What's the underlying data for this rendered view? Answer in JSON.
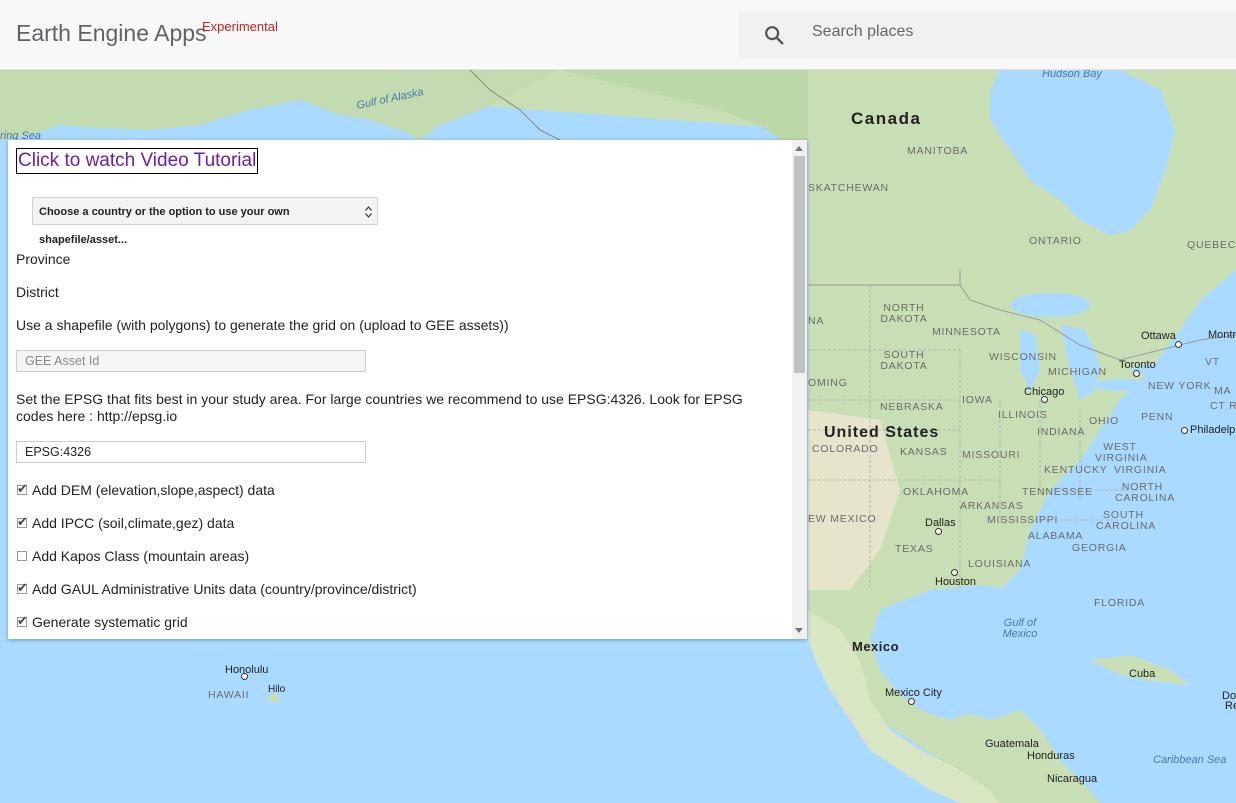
{
  "header": {
    "brand": "Earth Engine Apps",
    "badge": "Experimental",
    "search_placeholder": "Search places",
    "search_icon": "search-icon"
  },
  "panel": {
    "video_link": "Click to watch Video Tutorial",
    "country_select": "Choose a country or the option to use your own shapefile/asset...",
    "province_label": "Province",
    "district_label": "District",
    "shapefile_label": "Use a shapefile (with polygons) to generate the grid on (upload to GEE assets))",
    "asset_placeholder": "GEE Asset Id",
    "epsg_help": "Set the EPSG that fits best in your study area. For large countries we recommend to use EPSG:4326. Look for EPSG codes here : http://epsg.io",
    "epsg_value": "EPSG:4326",
    "checkboxes": [
      {
        "label": "Add DEM (elevation,slope,aspect) data",
        "checked": true
      },
      {
        "label": "Add IPCC (soil,climate,gez) data",
        "checked": true
      },
      {
        "label": "Add Kapos Class (mountain areas)",
        "checked": false
      },
      {
        "label": "Add GAUL Administrative Units data (country/province/district)",
        "checked": true
      },
      {
        "label": "Generate systematic grid",
        "checked": true
      }
    ]
  },
  "map": {
    "labels": {
      "canada": "Canada",
      "united_states": "United States",
      "mexico": "Mexico",
      "cuba": "Cuba",
      "hudson_bay": "Hudson Bay",
      "gulf_of_alaska": "Gulf of Alaska",
      "bering_sea": "ring Sea",
      "gulf_of_mexico": "Gulf of Mexico",
      "caribbean_sea": "Caribbean Sea",
      "manitoba": "MANITOBA",
      "saskatchewan": "SKATCHEWAN",
      "ontario": "ONTARIO",
      "quebec": "QUEBEC",
      "north_dakota": "NORTH DAKOTA",
      "south_dakota": "SOUTH DAKOTA",
      "minnesota": "MINNESOTA",
      "wisconsin": "WISCONSIN",
      "michigan": "MICHIGAN",
      "nebraska": "NEBRASKA",
      "iowa": "IOWA",
      "illinois": "ILLINOIS",
      "indiana": "INDIANA",
      "ohio": "OHIO",
      "penn": "PENN",
      "new_york": "NEW YORK",
      "vt": "VT",
      "ma": "MA",
      "ct": "CT RI",
      "kansas": "KANSAS",
      "missouri": "MISSOURI",
      "colorado": "COLORADO",
      "kentucky": "KENTUCKY",
      "west_virginia": "WEST VIRGINIA",
      "virginia": "VIRGINIA",
      "north_carolina": "NORTH CAROLINA",
      "south_carolina": "SOUTH CAROLINA",
      "tennessee": "TENNESSEE",
      "oklahoma": "OKLAHOMA",
      "arkansas": "ARKANSAS",
      "mississippi": "MISSISSIPPI",
      "alabama": "ALABAMA",
      "georgia": "GEORGIA",
      "texas": "TEXAS",
      "louisiana": "LOUISIANA",
      "florida": "FLORIDA",
      "new_mexico": "EW MEXICO",
      "wyoming": "OMING",
      "na": "NA",
      "hawaii": "HAWAII",
      "honolulu": "Honolulu",
      "hilo": "Hilo",
      "ottawa": "Ottawa",
      "montreal": "Montr",
      "toronto": "Toronto",
      "chicago": "Chicago",
      "philadelphia": "Philadelp",
      "dallas": "Dallas",
      "houston": "Houston",
      "mexico_city": "Mexico City",
      "guatemala": "Guatemala",
      "honduras": "Honduras",
      "nicaragua": "Nicaragua",
      "dominican": "Do",
      "dominican2": "Re"
    }
  }
}
